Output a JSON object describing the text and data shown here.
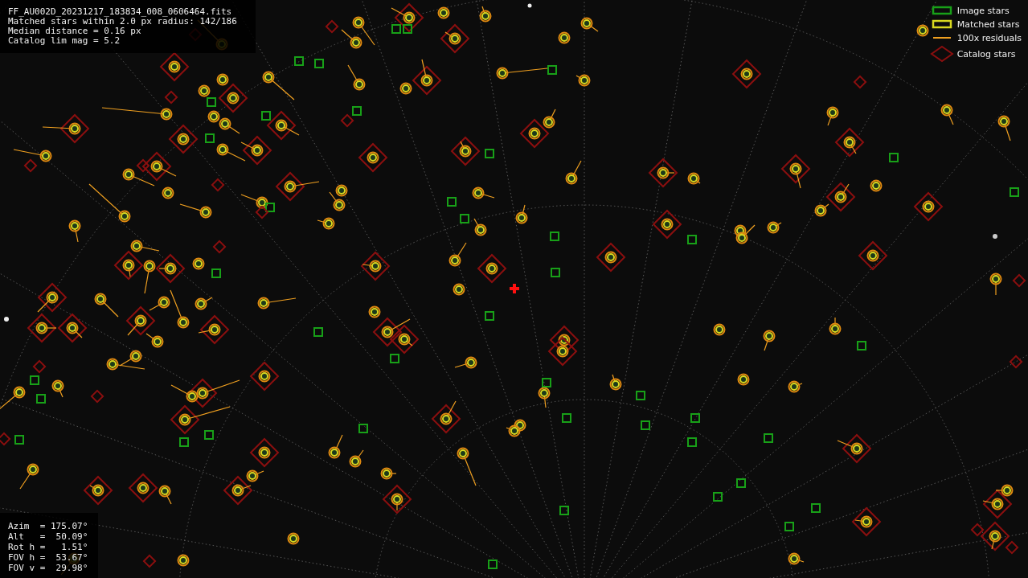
{
  "header": {
    "lines": [
      "FF_AU002D_20231217_183834_008_0606464.fits",
      "Matched stars within 2.0 px radius: 142/186",
      "Median distance = 0.16 px",
      "Catalog lim mag = 5.2"
    ]
  },
  "legend": [
    {
      "kind": "image",
      "label": "Image stars"
    },
    {
      "kind": "matched",
      "label": "Matched stars"
    },
    {
      "kind": "residual",
      "label": "100x residuals"
    },
    {
      "kind": "catalog",
      "label": "Catalog stars"
    }
  ],
  "pointing": {
    "lines": [
      "Azim  = 175.07°",
      "Alt   =  50.09°",
      "Rot h =   1.51°",
      "FOV h =  53.67°",
      "FOV v =  29.98°"
    ]
  }
}
